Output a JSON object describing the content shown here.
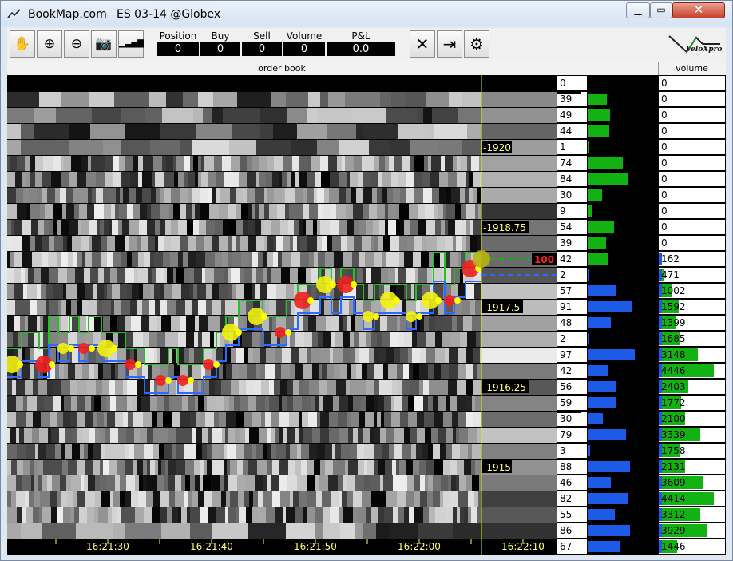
{
  "window": {
    "title": "BookMap.com",
    "symbol": "ES 03-14 @Globex",
    "minimize_glyph": "▁",
    "maximize_glyph": "▭",
    "close_glyph": "✕"
  },
  "toolbar": {
    "tools": [
      {
        "name": "pan-hand-icon",
        "glyph": "✋"
      },
      {
        "name": "zoom-in-icon",
        "glyph": "⊕"
      },
      {
        "name": "zoom-out-icon",
        "glyph": "⊖"
      },
      {
        "name": "camera-icon",
        "glyph": "📷"
      },
      {
        "name": "signal-bars-icon",
        "glyph": "▁▃▅▇"
      }
    ],
    "stats": [
      {
        "label": "Position",
        "value": "0"
      },
      {
        "label": "Buy",
        "value": "0"
      },
      {
        "label": "Sell",
        "value": "0"
      },
      {
        "label": "Volume",
        "value": "0"
      },
      {
        "label": "P&L",
        "value": "0.0"
      }
    ],
    "actions": [
      {
        "name": "cancel-orders-icon",
        "glyph": "✕"
      },
      {
        "name": "exit-position-icon",
        "glyph": "⇥"
      },
      {
        "name": "settings-gear-icon",
        "glyph": "⚙"
      }
    ],
    "logo_text": "VeloXpro"
  },
  "header": {
    "order_book": "order book",
    "volume": "volume"
  },
  "colors": {
    "bid_bar": "#13b213",
    "ask_bar": "#1d5be6",
    "price_label": "#ffff66",
    "order_label": "#ff2020"
  },
  "price_labels": [
    {
      "row": 4,
      "text": "-1920"
    },
    {
      "row": 9,
      "text": "-1918.75"
    },
    {
      "row": 14,
      "text": "-1917.5"
    },
    {
      "row": 19,
      "text": "-1916.25"
    },
    {
      "row": 24,
      "text": "-1915"
    }
  ],
  "order_marker": {
    "row": 11,
    "qty": "100"
  },
  "time_labels": [
    "16:21:30",
    "16:21:40",
    "16:21:50",
    "16:22:00",
    "16:22:10"
  ],
  "ladder": [
    {
      "size": "0",
      "volume": "0",
      "side": "none",
      "bar": 0,
      "vbar": 0
    },
    {
      "size": "39",
      "volume": "0",
      "side": "bid",
      "bar": 27,
      "vbar": 0
    },
    {
      "size": "49",
      "volume": "0",
      "side": "bid",
      "bar": 31,
      "vbar": 0
    },
    {
      "size": "44",
      "volume": "0",
      "side": "bid",
      "bar": 30,
      "vbar": 0
    },
    {
      "size": "1",
      "volume": "0",
      "side": "bid",
      "bar": 1,
      "vbar": 0
    },
    {
      "size": "74",
      "volume": "0",
      "side": "bid",
      "bar": 50,
      "vbar": 0
    },
    {
      "size": "84",
      "volume": "0",
      "side": "bid",
      "bar": 57,
      "vbar": 0
    },
    {
      "size": "30",
      "volume": "0",
      "side": "bid",
      "bar": 20,
      "vbar": 0
    },
    {
      "size": "9",
      "volume": "0",
      "side": "bid",
      "bar": 6,
      "vbar": 0
    },
    {
      "size": "54",
      "volume": "0",
      "side": "bid",
      "bar": 37,
      "vbar": 0
    },
    {
      "size": "39",
      "volume": "0",
      "side": "bid",
      "bar": 26,
      "vbar": 0
    },
    {
      "size": "42",
      "volume": "162",
      "side": "bid",
      "bar": 28,
      "vbar": 162
    },
    {
      "size": "2",
      "volume": "471",
      "side": "ask",
      "bar": 1,
      "vbar": 471
    },
    {
      "size": "57",
      "volume": "1002",
      "side": "ask",
      "bar": 40,
      "vbar": 1002
    },
    {
      "size": "91",
      "volume": "1592",
      "side": "ask",
      "bar": 64,
      "vbar": 1592
    },
    {
      "size": "48",
      "volume": "1399",
      "side": "ask",
      "bar": 33,
      "vbar": 1399
    },
    {
      "size": "2",
      "volume": "1685",
      "side": "ask",
      "bar": 1,
      "vbar": 1685
    },
    {
      "size": "97",
      "volume": "3148",
      "side": "ask",
      "bar": 68,
      "vbar": 3148
    },
    {
      "size": "42",
      "volume": "4446",
      "side": "ask",
      "bar": 29,
      "vbar": 4446
    },
    {
      "size": "56",
      "volume": "2403",
      "side": "ask",
      "bar": 39,
      "vbar": 2403
    },
    {
      "size": "59",
      "volume": "1772",
      "side": "ask",
      "bar": 41,
      "vbar": 1772
    },
    {
      "size": "30",
      "volume": "2100",
      "side": "ask",
      "bar": 21,
      "vbar": 2100
    },
    {
      "size": "79",
      "volume": "3339",
      "side": "ask",
      "bar": 55,
      "vbar": 3339
    },
    {
      "size": "3",
      "volume": "1758",
      "side": "ask",
      "bar": 2,
      "vbar": 1758
    },
    {
      "size": "88",
      "volume": "2131",
      "side": "ask",
      "bar": 61,
      "vbar": 2131
    },
    {
      "size": "46",
      "volume": "3609",
      "side": "ask",
      "bar": 32,
      "vbar": 3609
    },
    {
      "size": "82",
      "volume": "4414",
      "side": "ask",
      "bar": 57,
      "vbar": 4414
    },
    {
      "size": "55",
      "volume": "3312",
      "side": "ask",
      "bar": 38,
      "vbar": 3312
    },
    {
      "size": "86",
      "volume": "3929",
      "side": "ask",
      "bar": 60,
      "vbar": 3929
    },
    {
      "size": "67",
      "volume": "1446",
      "side": "ask",
      "bar": 47,
      "vbar": 1446
    }
  ]
}
